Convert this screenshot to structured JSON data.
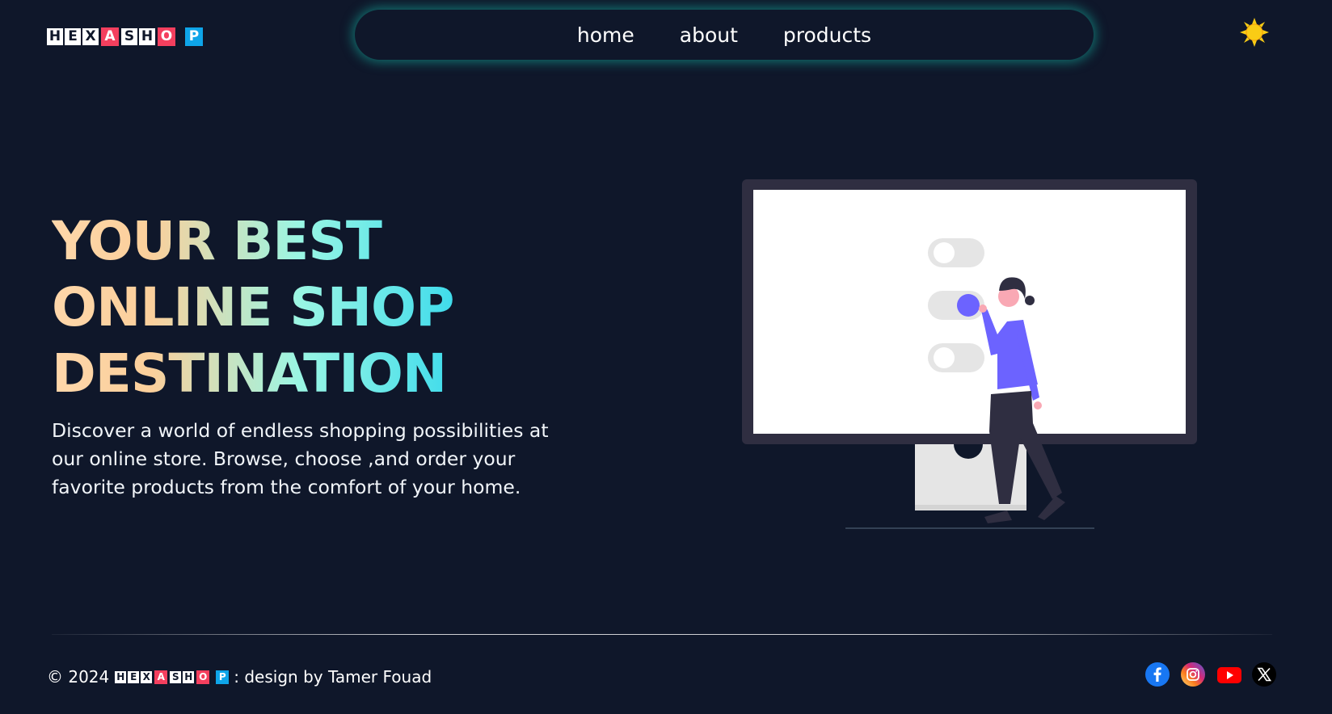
{
  "brand": {
    "letters": [
      "H",
      "E",
      "X",
      "A",
      "S",
      "H",
      "O",
      "P"
    ]
  },
  "nav": {
    "items": [
      "home",
      "about",
      "products"
    ]
  },
  "theme_toggle": {
    "icon": "sun-icon"
  },
  "hero": {
    "title_lines": [
      "YOUR BEST",
      "ONLINE SHOP",
      "DESTINATION"
    ],
    "description": "Discover a world of endless shopping possibilities at our online store. Browse, choose ,and order your favorite products from the comfort of your home."
  },
  "footer": {
    "copyright": "© 2024",
    "credit": ": design by Tamer Fouad"
  },
  "socials": [
    "facebook-icon",
    "instagram-icon",
    "youtube-icon",
    "x-icon"
  ],
  "colors": {
    "background": "#0f172a",
    "glow": "#14b8a6",
    "logo_red": "#f43f5e",
    "logo_blue": "#0ea5e9",
    "accent_purple": "#6c63ff",
    "sun": "#facc15"
  }
}
